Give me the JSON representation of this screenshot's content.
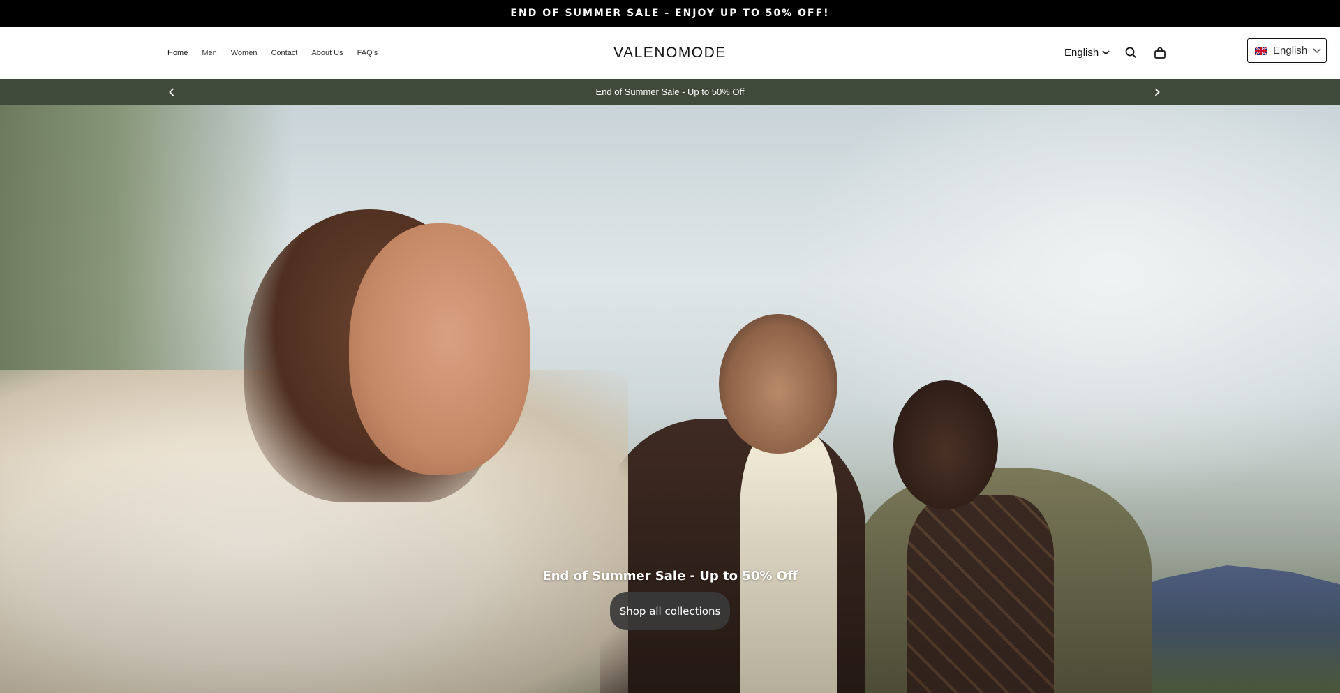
{
  "topbar": {
    "text": "END OF SUMMER SALE - ENJOY UP TO 50% OFF!"
  },
  "header": {
    "nav": [
      "Home",
      "Men",
      "Women",
      "Contact",
      "About Us",
      "FAQ's"
    ],
    "logo": "VALENOMODE",
    "language": "English",
    "icons": [
      "search-icon",
      "cart-icon",
      "chevron-down-icon"
    ]
  },
  "language_widget": {
    "label": "English",
    "flag": "uk-flag-icon"
  },
  "announcement": {
    "text": "End of Summer Sale - Up to 50% Off",
    "prev_icon": "chevron-left-icon",
    "next_icon": "chevron-right-icon"
  },
  "hero": {
    "title": "End of Summer Sale - Up to 50% Off",
    "button": "Shop all collections"
  },
  "colors": {
    "topbar_bg": "#000000",
    "announcement_bg": "#3f4a3b",
    "button_bg": "#3a3a3a",
    "text": "#121212"
  }
}
